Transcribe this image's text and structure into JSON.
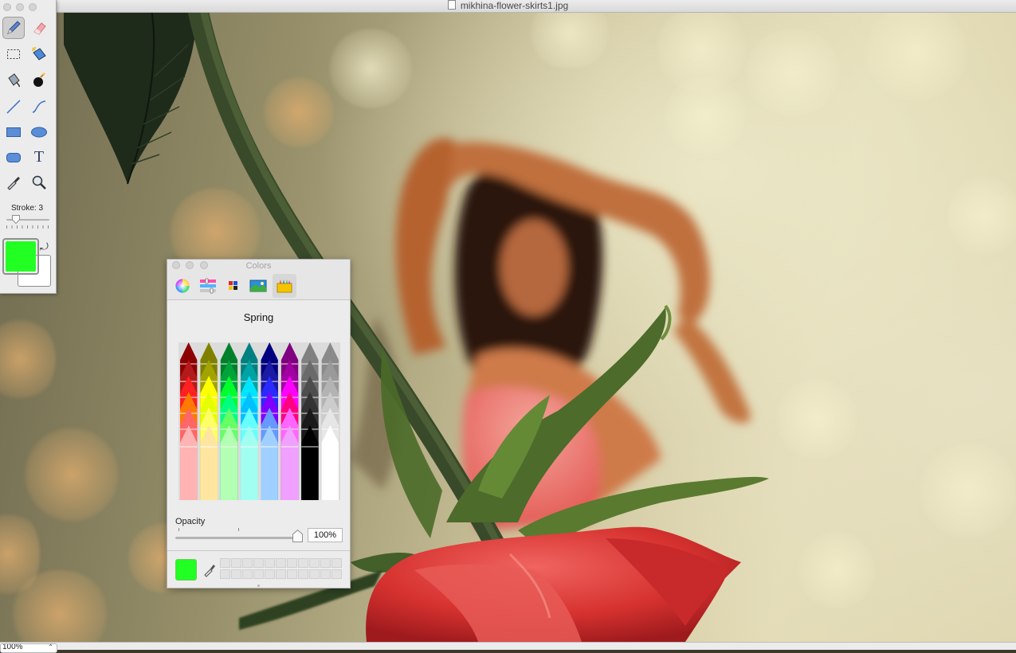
{
  "window": {
    "title": "mikhina-flower-skirts1.jpg"
  },
  "tools": {
    "items": [
      {
        "name": "pencil-tool",
        "icon": "pencil-icon",
        "selected": true
      },
      {
        "name": "eraser-tool",
        "icon": "eraser-icon"
      },
      {
        "name": "rect-select-tool",
        "icon": "marquee-icon"
      },
      {
        "name": "magic-wand-tool",
        "icon": "magic-wand-icon"
      },
      {
        "name": "paint-bucket-tool",
        "icon": "paint-bucket-icon"
      },
      {
        "name": "spray-tool",
        "icon": "spray-can-icon"
      },
      {
        "name": "line-tool",
        "icon": "line-icon"
      },
      {
        "name": "curve-tool",
        "icon": "curve-icon"
      },
      {
        "name": "rectangle-tool",
        "icon": "rectangle-icon"
      },
      {
        "name": "ellipse-tool",
        "icon": "ellipse-icon"
      },
      {
        "name": "rounded-rect-tool",
        "icon": "rounded-rectangle-icon"
      },
      {
        "name": "text-tool",
        "icon": "text-icon"
      },
      {
        "name": "eyedropper-tool",
        "icon": "eyedropper-icon"
      },
      {
        "name": "zoom-tool",
        "icon": "magnifier-icon"
      }
    ],
    "text_tool_glyph": "T",
    "stroke_label": "Stroke: 3",
    "stroke_value": 3,
    "foreground_color": "#22ff22",
    "background_color": "#ffffff"
  },
  "colors_panel": {
    "title": "Colors",
    "tabs": [
      {
        "name": "color-wheel",
        "icon": "color-wheel-icon"
      },
      {
        "name": "color-sliders",
        "icon": "color-sliders-icon"
      },
      {
        "name": "color-palettes",
        "icon": "color-palettes-icon"
      },
      {
        "name": "image-palettes",
        "icon": "image-palette-icon"
      },
      {
        "name": "crayons",
        "icon": "crayons-icon",
        "active": true
      }
    ],
    "crayon_set_name": "Spring",
    "opacity_label": "Opacity",
    "opacity_value": "100%",
    "current_color": "#22ff22",
    "crayon_rows": [
      [
        "#8b0000",
        "#808000",
        "#00802a",
        "#008080",
        "#000080",
        "#800080",
        "#808080",
        "#8a8a8a"
      ],
      [
        "#b31a1a",
        "#a3a300",
        "#00a33a",
        "#00a3a3",
        "#1a1aa3",
        "#a300a3",
        "#6a6a6a",
        "#9a9a9a"
      ],
      [
        "#ff2020",
        "#ffff00",
        "#00ff2a",
        "#00e5ff",
        "#2a2aff",
        "#ff00ff",
        "#4d4d4d",
        "#b3b3b3"
      ],
      [
        "#ff7a00",
        "#e6ff00",
        "#00ff80",
        "#00c0ff",
        "#8000ff",
        "#ff0080",
        "#333333",
        "#cccccc"
      ],
      [
        "#ff6666",
        "#ffff66",
        "#66ff66",
        "#66ffff",
        "#6699ff",
        "#ff66ff",
        "#1a1a1a",
        "#e6e6e6"
      ],
      [
        "#ffb3b3",
        "#ffe6a0",
        "#b3ffb3",
        "#a0fff0",
        "#a0d0ff",
        "#f0a0ff",
        "#000000",
        "#ffffff"
      ]
    ]
  },
  "statusbar": {
    "zoom": "100%"
  }
}
